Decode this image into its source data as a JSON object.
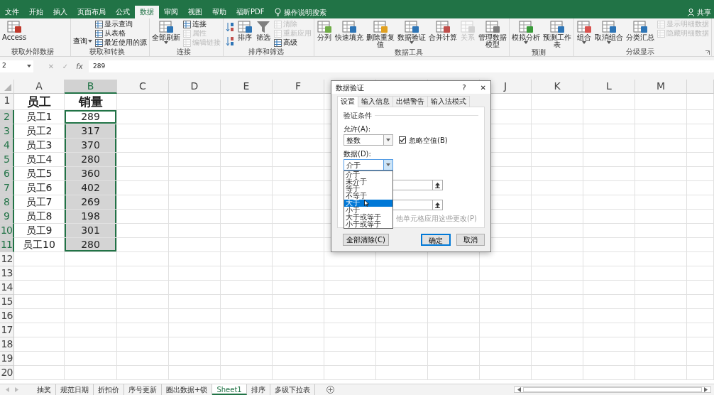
{
  "ribbon_tabs": [
    {
      "label": "文件",
      "selected": false
    },
    {
      "label": "开始",
      "selected": false
    },
    {
      "label": "插入",
      "selected": false
    },
    {
      "label": "页面布局",
      "selected": false
    },
    {
      "label": "公式",
      "selected": false
    },
    {
      "label": "数据",
      "selected": true
    },
    {
      "label": "审阅",
      "selected": false
    },
    {
      "label": "视图",
      "selected": false
    },
    {
      "label": "帮助",
      "selected": false
    },
    {
      "label": "福昕PDF",
      "selected": false
    }
  ],
  "tell_me": "操作说明搜索",
  "share": "共享",
  "ribbon_groups": [
    {
      "label": "获取外部数据",
      "launcher": false,
      "buttons": [
        {
          "kind": "large",
          "label": "Access",
          "disabled": false,
          "dropdown": false
        }
      ]
    },
    {
      "label": "获取和转换",
      "launcher": false,
      "buttons": [
        {
          "kind": "menu",
          "label": "查询",
          "disabled": false,
          "dropdown": true
        },
        {
          "kind": "small",
          "label": "显示查询",
          "disabled": false
        },
        {
          "kind": "small",
          "label": "从表格",
          "disabled": false
        },
        {
          "kind": "small",
          "label": "最近使用的源",
          "disabled": false
        }
      ]
    },
    {
      "label": "连接",
      "launcher": false,
      "buttons": [
        {
          "kind": "large",
          "label": "全部刷新",
          "disabled": false,
          "dropdown": true
        },
        {
          "kind": "small",
          "label": "连接",
          "disabled": false
        },
        {
          "kind": "small",
          "label": "属性",
          "disabled": true
        },
        {
          "kind": "small",
          "label": "编辑链接",
          "disabled": true
        }
      ]
    },
    {
      "label": "排序和筛选",
      "launcher": false,
      "buttons": [
        {
          "kind": "sort"
        },
        {
          "kind": "large",
          "label": "排序",
          "disabled": false,
          "dropdown": false
        },
        {
          "kind": "large",
          "label": "筛选",
          "disabled": false,
          "dropdown": false
        },
        {
          "kind": "small",
          "label": "清除",
          "disabled": true
        },
        {
          "kind": "small",
          "label": "重新应用",
          "disabled": true
        },
        {
          "kind": "small",
          "label": "高级",
          "disabled": false
        }
      ]
    },
    {
      "label": "数据工具",
      "launcher": false,
      "buttons": [
        {
          "kind": "large",
          "label": "分列",
          "disabled": false,
          "dropdown": false
        },
        {
          "kind": "large",
          "label": "快速填充",
          "disabled": false,
          "dropdown": false
        },
        {
          "kind": "large",
          "label": "删除重复值",
          "disabled": false,
          "dropdown": false
        },
        {
          "kind": "large",
          "label": "数据验证",
          "disabled": false,
          "dropdown": true
        },
        {
          "kind": "large",
          "label": "合并计算",
          "disabled": false,
          "dropdown": false
        },
        {
          "kind": "large",
          "label": "关系",
          "disabled": true,
          "dropdown": false
        },
        {
          "kind": "large",
          "label": "管理数据模型",
          "disabled": false,
          "dropdown": false
        }
      ]
    },
    {
      "label": "预测",
      "launcher": false,
      "buttons": [
        {
          "kind": "large",
          "label": "模拟分析",
          "disabled": false,
          "dropdown": true
        },
        {
          "kind": "large",
          "label": "预测工作表",
          "disabled": false,
          "dropdown": false
        }
      ]
    },
    {
      "label": "分级显示",
      "launcher": true,
      "buttons": [
        {
          "kind": "large",
          "label": "组合",
          "disabled": false,
          "dropdown": true
        },
        {
          "kind": "large",
          "label": "取消组合",
          "disabled": false,
          "dropdown": true
        },
        {
          "kind": "large",
          "label": "分类汇总",
          "disabled": false,
          "dropdown": false
        },
        {
          "kind": "small",
          "label": "显示明细数据",
          "disabled": true
        },
        {
          "kind": "small",
          "label": "隐藏明细数据",
          "disabled": true
        }
      ]
    }
  ],
  "formula_bar": {
    "name_box": "2",
    "cancel": "✕",
    "enter": "✓",
    "function_label": "fx",
    "value": "289"
  },
  "columns_left": [
    {
      "label": "A",
      "selected": false
    },
    {
      "label": "B",
      "selected": true
    }
  ],
  "columns_mid": [
    {
      "label": "C",
      "selected": false
    },
    {
      "label": "D",
      "selected": false
    },
    {
      "label": "E",
      "selected": false
    },
    {
      "label": "F",
      "selected": false
    }
  ],
  "columns_right": [
    {
      "label": "J",
      "selected": false
    },
    {
      "label": "K",
      "selected": false
    },
    {
      "label": "L",
      "selected": false
    },
    {
      "label": "M",
      "selected": false
    }
  ],
  "rows": [
    {
      "number": "1",
      "kind": "header",
      "cells": [
        "员工",
        "销量"
      ],
      "selected": false
    },
    {
      "number": "2",
      "kind": "data",
      "cells": [
        "员工1",
        "289"
      ],
      "selected": true,
      "active": true
    },
    {
      "number": "3",
      "kind": "data",
      "cells": [
        "员工2",
        "317"
      ],
      "selected": true
    },
    {
      "number": "4",
      "kind": "data",
      "cells": [
        "员工3",
        "370"
      ],
      "selected": true
    },
    {
      "number": "5",
      "kind": "data",
      "cells": [
        "员工4",
        "280"
      ],
      "selected": true
    },
    {
      "number": "6",
      "kind": "data",
      "cells": [
        "员工5",
        "360"
      ],
      "selected": true
    },
    {
      "number": "7",
      "kind": "data",
      "cells": [
        "员工6",
        "402"
      ],
      "selected": true
    },
    {
      "number": "8",
      "kind": "data",
      "cells": [
        "员工7",
        "269"
      ],
      "selected": true
    },
    {
      "number": "9",
      "kind": "data",
      "cells": [
        "员工8",
        "198"
      ],
      "selected": true
    },
    {
      "number": "10",
      "kind": "data",
      "cells": [
        "员工9",
        "301"
      ],
      "selected": true
    },
    {
      "number": "11",
      "kind": "data",
      "cells": [
        "员工10",
        "280"
      ],
      "selected": true
    },
    {
      "number": "12",
      "kind": "data",
      "selected": false
    },
    {
      "number": "13",
      "kind": "data",
      "selected": false
    },
    {
      "number": "14",
      "kind": "data",
      "selected": false
    },
    {
      "number": "15",
      "kind": "data",
      "selected": false
    },
    {
      "number": "16",
      "kind": "data",
      "selected": false
    },
    {
      "number": "17",
      "kind": "data",
      "selected": false
    },
    {
      "number": "18",
      "kind": "data",
      "selected": false
    },
    {
      "number": "19",
      "kind": "data",
      "selected": false
    },
    {
      "number": "20",
      "kind": "data",
      "selected": false
    }
  ],
  "sheet_tabs": [
    {
      "label": "抽奖",
      "selected": false
    },
    {
      "label": "规范日期",
      "selected": false
    },
    {
      "label": "折扣价",
      "selected": false
    },
    {
      "label": "序号更新",
      "selected": false
    },
    {
      "label": "圈出数据+锁",
      "selected": false
    },
    {
      "label": "Sheet1",
      "selected": true
    },
    {
      "label": "排序",
      "selected": false
    },
    {
      "label": "多级下拉表",
      "selected": false
    }
  ],
  "dialog": {
    "title": "数据验证",
    "help": "?",
    "close": "✕",
    "tabs": [
      {
        "label": "设置",
        "selected": true
      },
      {
        "label": "输入信息",
        "selected": false
      },
      {
        "label": "出错警告",
        "selected": false
      },
      {
        "label": "输入法模式",
        "selected": false
      }
    ],
    "section": "验证条件",
    "allow_label": "允许(A):",
    "allow_value": "整数",
    "ignore_blank": {
      "label": "忽略空值(B)",
      "checked": true
    },
    "data_label": "数据(D):",
    "data_value": "介于",
    "dropdown_open": true,
    "options": [
      {
        "label": "介于",
        "selected": false
      },
      {
        "label": "未介于",
        "selected": false
      },
      {
        "label": "等于",
        "selected": false
      },
      {
        "label": "不等于",
        "selected": false
      },
      {
        "label": "大于",
        "selected": true
      },
      {
        "label": "小于",
        "selected": false
      },
      {
        "label": "大于或等于",
        "selected": false
      },
      {
        "label": "小于或等于",
        "selected": false
      }
    ],
    "fields": [
      {
        "kind": "range"
      },
      {
        "kind": "range"
      }
    ],
    "apply_all": "他单元格应用这些更改(P)",
    "buttons": [
      {
        "label": "全部清除(C)",
        "kind": "default"
      },
      {
        "label": "确定",
        "kind": "primary"
      },
      {
        "label": "取消",
        "kind": "default"
      }
    ]
  }
}
